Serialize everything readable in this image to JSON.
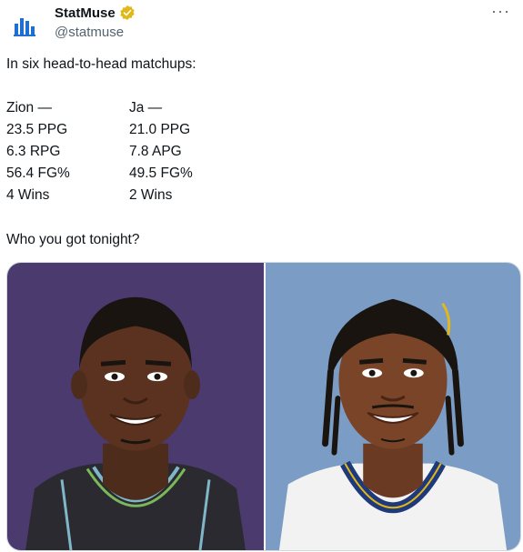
{
  "tweet": {
    "author_name": "StatMuse",
    "author_handle": "@statmuse",
    "verified_icon": "gold-verified-badge",
    "more_icon": "more-dots-icon",
    "intro": "In six head-to-head matchups:",
    "stats_rows": [
      [
        "Zion —",
        "Ja —"
      ],
      [
        "23.5 PPG",
        "21.0 PPG"
      ],
      [
        "6.3 RPG",
        "7.8 APG"
      ],
      [
        "56.4 FG%",
        "49.5 FG%"
      ],
      [
        "4 Wins",
        "2 Wins"
      ]
    ],
    "question": "Who you got tonight?"
  },
  "media": {
    "left_image": "zion-illustration",
    "right_image": "ja-illustration",
    "left_bg": "#4a3a6e",
    "right_bg": "#7b9cc4"
  },
  "colors": {
    "verified_gold": "#e2b719",
    "handle_gray": "#536471",
    "logo_blue": "#1d6fd1"
  }
}
